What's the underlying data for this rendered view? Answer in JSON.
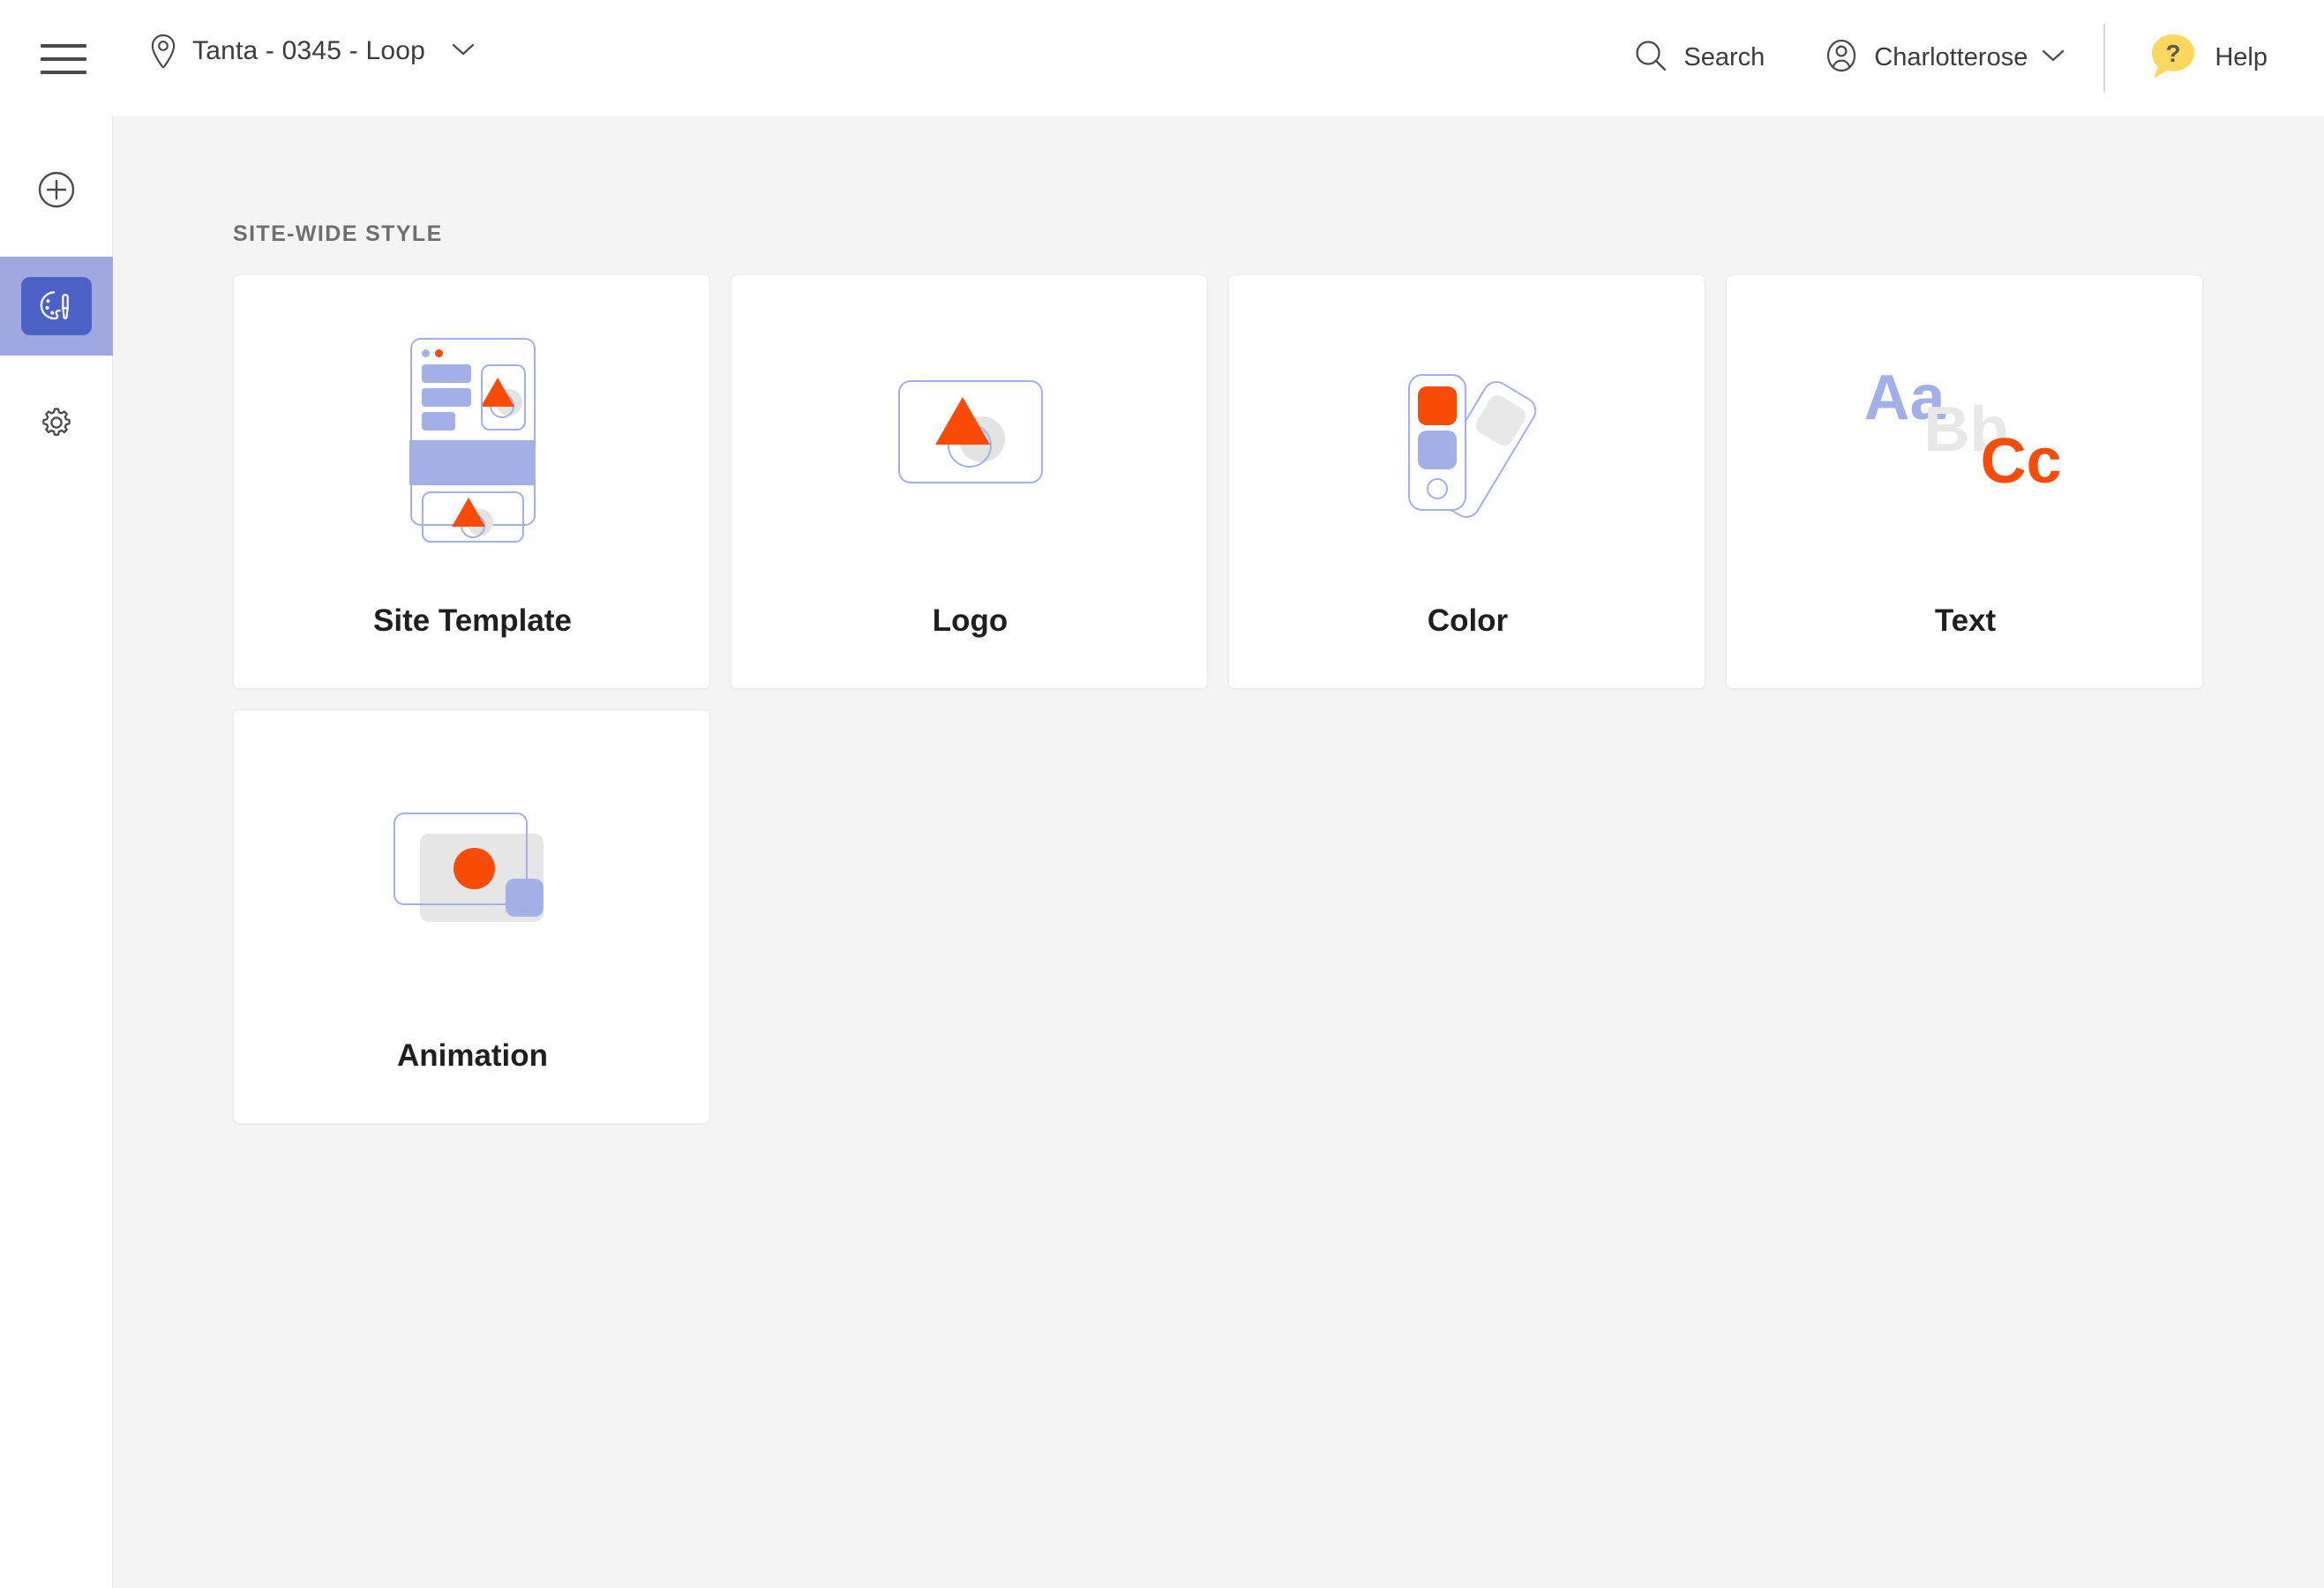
{
  "header": {
    "menu_icon": "hamburger-menu-icon",
    "location_icon": "map-pin-icon",
    "site_name": "Tanta - 0345 -  Loop",
    "site_chevron_icon": "chevron-down-icon",
    "search": {
      "icon": "search-icon",
      "label": "Search"
    },
    "account": {
      "icon": "user-circle-icon",
      "label": "Charlotterose",
      "chevron_icon": "chevron-down-icon"
    },
    "help": {
      "icon": "help-speech-bubble-icon",
      "label": "Help",
      "glyph": "?"
    }
  },
  "sidebar": {
    "items": [
      {
        "name": "add",
        "icon": "plus-circle-icon",
        "active": false
      },
      {
        "name": "style",
        "icon": "palette-brush-icon",
        "active": true
      },
      {
        "name": "settings",
        "icon": "gear-icon",
        "active": false
      }
    ]
  },
  "main": {
    "section_title": "SITE-WIDE STYLE",
    "cards": [
      {
        "label": "Site Template",
        "thumb": "site-template-wireframe-thumbnail"
      },
      {
        "label": "Logo",
        "thumb": "logo-mark-thumbnail"
      },
      {
        "label": "Color",
        "thumb": "color-swatch-thumbnail"
      },
      {
        "label": "Text",
        "thumb": "typography-thumbnail"
      },
      {
        "label": "Animation",
        "thumb": "animation-frames-thumbnail"
      }
    ],
    "text_thumb_glyphs": {
      "a": "Aa",
      "b": "Bb",
      "c": "Cc"
    }
  },
  "colors": {
    "accent_orange": "#f84c06",
    "accent_blue": "#a3b0e8",
    "active_tile": "#4b61c6",
    "active_strip": "#9fa9e0",
    "help_yellow": "#fbd85d",
    "page_bg": "#f4f4f4",
    "card_bg": "#ffffff",
    "gray_shape": "#e6e6e6"
  }
}
